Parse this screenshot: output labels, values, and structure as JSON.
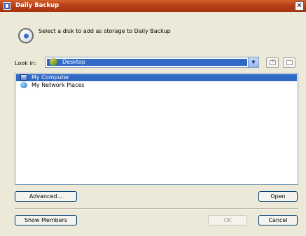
{
  "window": {
    "title": "Daily Backup",
    "close_glyph": "✕"
  },
  "prompt": {
    "text": "Select a disk to add as storage to Daily Backup",
    "icon": "disk-icon"
  },
  "lookin": {
    "label": "Look in:",
    "selected": "Desktop",
    "selected_icon": "desktop-icon",
    "dropdown_glyph": "▼",
    "tool_icons": [
      "up-folder-icon",
      "new-folder-icon"
    ]
  },
  "list": {
    "items": [
      {
        "label": "My Computer",
        "icon": "computer-icon",
        "selected": true
      },
      {
        "label": "My Network Places",
        "icon": "network-places-icon",
        "selected": false
      }
    ]
  },
  "buttons": {
    "advanced": "Advanced...",
    "open": "Open",
    "show_members": "Show Members",
    "ok": "OK",
    "cancel": "Cancel"
  },
  "colors": {
    "title_bar": "#b8401a",
    "selection": "#316ac5",
    "dialog_bg": "#ece9d8"
  }
}
